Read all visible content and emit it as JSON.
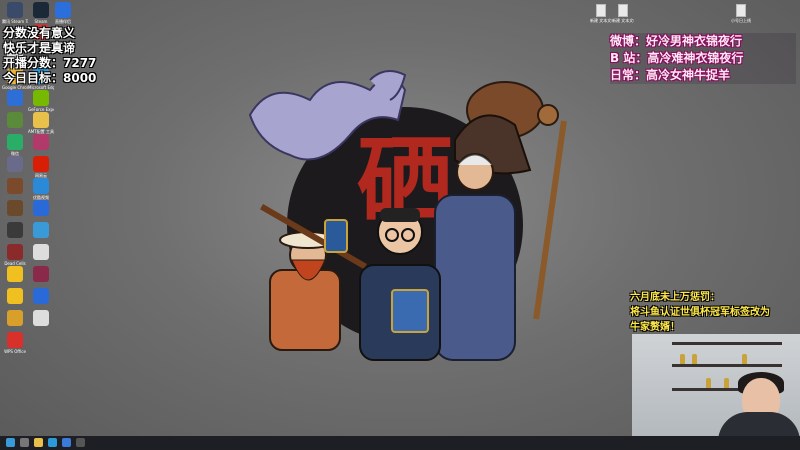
{
  "desktop_icons": [
    {
      "label": "腾讯 Steam Trouble",
      "icon": "game-icon",
      "color": "#3a4a6a"
    },
    {
      "label": "Steam",
      "icon": "steam-icon",
      "color": "#1b2838"
    },
    {
      "label": "直播伴侣",
      "icon": "stream-icon",
      "color": "#2a6fdb"
    },
    {
      "label": "",
      "icon": "app-icon",
      "color": "#c23b3b"
    },
    {
      "label": "",
      "icon": "app-icon",
      "color": "#ddd"
    },
    {
      "label": "",
      "icon": "app-icon",
      "color": "#444"
    },
    {
      "label": "Google Chrome",
      "icon": "chrome-icon",
      "color": "#e8b73a"
    },
    {
      "label": "Microsoft Edge",
      "icon": "edge-icon",
      "color": "#2a9ad8"
    },
    {
      "label": "",
      "icon": "app-icon",
      "color": "#2d6fd6"
    },
    {
      "label": "GeForce Experience",
      "icon": "nvidia-icon",
      "color": "#76b900"
    },
    {
      "label": "",
      "icon": "app-icon",
      "color": "#5a8a3a"
    },
    {
      "label": "AMT配置 工具",
      "icon": "folder-icon",
      "color": "#e8c04a"
    },
    {
      "label": "微信",
      "icon": "wechat-icon",
      "color": "#2aae67"
    },
    {
      "label": "",
      "icon": "app-icon",
      "color": "#b23a6a"
    },
    {
      "label": "",
      "icon": "app-icon",
      "color": "#6a6a8a"
    },
    {
      "label": "网易云",
      "icon": "netease-icon",
      "color": "#d81e06"
    },
    {
      "label": "",
      "icon": "app-icon",
      "color": "#7a4a2a"
    },
    {
      "label": "优酷视频",
      "icon": "video-icon",
      "color": "#2a8ad8"
    },
    {
      "label": "",
      "icon": "app-icon",
      "color": "#6a4a2a"
    },
    {
      "label": "",
      "icon": "app-icon",
      "color": "#2a6ad8"
    },
    {
      "label": "",
      "icon": "app-icon",
      "color": "#3a3a3a"
    },
    {
      "label": "",
      "icon": "app-icon",
      "color": "#3a9ad8"
    },
    {
      "label": "Dead Cells",
      "icon": "game-icon",
      "color": "#8a2a2a"
    },
    {
      "label": "",
      "icon": "app-icon",
      "color": "#ddd"
    },
    {
      "label": "",
      "icon": "app-icon",
      "color": "#f0c020"
    },
    {
      "label": "",
      "icon": "app-icon",
      "color": "#8a2a4a"
    },
    {
      "label": "",
      "icon": "app-icon",
      "color": "#f0c020"
    },
    {
      "label": "",
      "icon": "app-icon",
      "color": "#2a6ad8"
    },
    {
      "label": "",
      "icon": "app-icon",
      "color": "#d8a02a"
    },
    {
      "label": "",
      "icon": "app-icon",
      "color": "#ddd"
    },
    {
      "label": "WPS Office",
      "icon": "wps-icon",
      "color": "#d8302a"
    }
  ],
  "desktop_files": [
    {
      "label": "新建 文本文档"
    },
    {
      "label": "新建 文本文档"
    },
    {
      "label": "小号日上线"
    }
  ],
  "score": {
    "line1": "分数没有意义",
    "line2": "快乐才是真谛",
    "line3": "开播分数：7277",
    "line4": "今日目标：8000"
  },
  "social": {
    "weibo": "微博：好冷男神衣锦夜行",
    "bilibili": "B 站：高冷难神衣锦夜行",
    "daily": "日常：高冷女神牛捉羊"
  },
  "notice": {
    "line1": "六月底未上万惩罚：",
    "line2": "将斗鱼认证世俱杯冠军标签改为",
    "line3": "牛家赘婿！"
  },
  "artwork": {
    "character": "硒"
  },
  "colors": {
    "score_text": "#ffffff",
    "social_text": "#ffe6f4",
    "notice_text": "#ffe94a",
    "taskbar": "#1d1f24"
  }
}
